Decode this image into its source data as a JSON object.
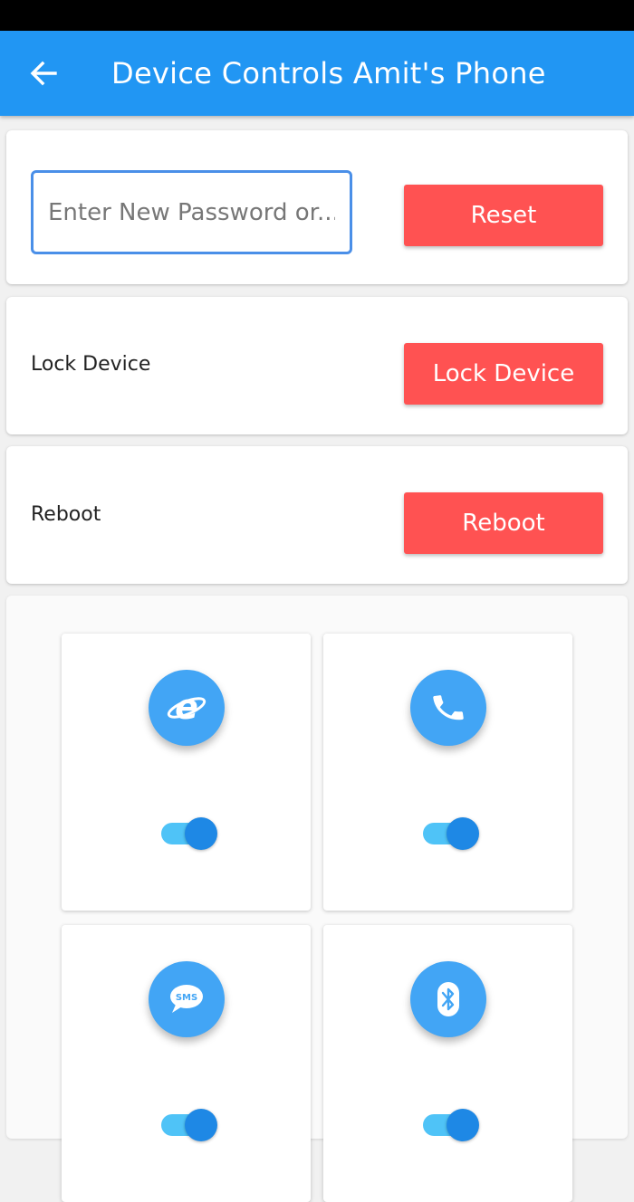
{
  "header": {
    "title": "Device Controls Amit's Phone",
    "back_icon": "arrow-left-icon",
    "color": "#2196f3"
  },
  "password_card": {
    "input_placeholder": "Enter New Password or...",
    "input_value": "",
    "button_label": "Reset"
  },
  "lock_card": {
    "label": "Lock Device",
    "button_label": "Lock Device"
  },
  "reboot_card": {
    "label": "Reboot",
    "button_label": "Reboot"
  },
  "colors": {
    "accent_button": "#ff5252",
    "icon_circle": "#42a5f5",
    "toggle_track": "#4fc3f7",
    "toggle_thumb": "#1e88e5"
  },
  "features": [
    {
      "icon": "internet-explorer-icon",
      "enabled": true
    },
    {
      "icon": "phone-icon",
      "enabled": true
    },
    {
      "icon": "sms-icon",
      "icon_text": "SMS",
      "enabled": true
    },
    {
      "icon": "bluetooth-icon",
      "enabled": true
    }
  ]
}
